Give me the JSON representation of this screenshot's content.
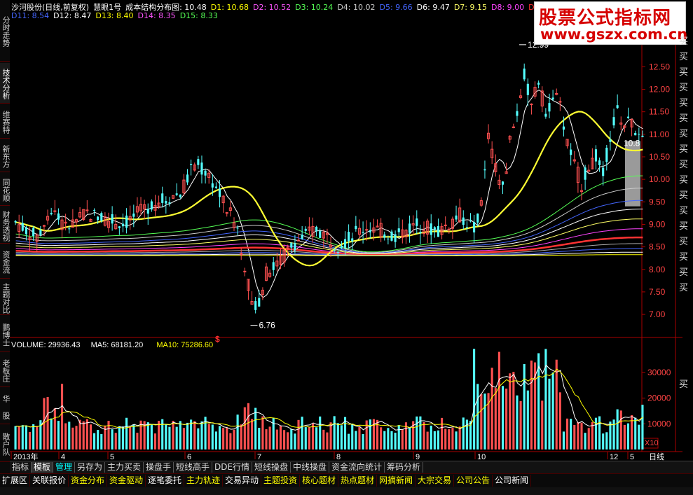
{
  "left_tabs": [
    "分时走势",
    "技术分析",
    "维赛特",
    "新东方",
    "同花顺",
    "财务透视",
    "资金流",
    "主题对比",
    "鹏博士",
    "老板庄",
    "华 股",
    "散户队"
  ],
  "header": {
    "line1": [
      {
        "text": "沙河股份(日线,前复权)",
        "color": "#ffffff"
      },
      {
        "text": "慧眼1号",
        "color": "#ffffff"
      },
      {
        "text": "成本结构分布图: 10.48",
        "color": "#ffffff"
      },
      {
        "text": "D1: 10.68",
        "color": "#ffff00"
      },
      {
        "text": "D2: 10.52",
        "color": "#ff55ff"
      },
      {
        "text": "D3: 10.24",
        "color": "#55ff55"
      },
      {
        "text": "D4: 10.02",
        "color": "#cccccc"
      },
      {
        "text": "D5: 9.66",
        "color": "#4466ff"
      },
      {
        "text": "D6: 9.47",
        "color": "#ffffff"
      },
      {
        "text": "D7: 9.15",
        "color": "#ffff66"
      },
      {
        "text": "D8: 9.00",
        "color": "#ff44ff"
      },
      {
        "text": "D9",
        "color": "#ff3333"
      }
    ],
    "line2": [
      {
        "text": "D11: 8.54",
        "color": "#4466ff"
      },
      {
        "text": "D12: 8.47",
        "color": "#ffffff"
      },
      {
        "text": "D13: 8.40",
        "color": "#ffff00"
      },
      {
        "text": "D14: 8.35",
        "color": "#ff55ff"
      },
      {
        "text": "D15: 8.33",
        "color": "#55ff55"
      }
    ]
  },
  "watermark": {
    "title": "股票公式指标网",
    "url": "www.gszx.com.cn"
  },
  "price_axis": [
    "12.50",
    "12.00",
    "11.50",
    "11.00",
    "10.50",
    "10.00",
    "9.50",
    "9.00",
    "8.50",
    "8.00",
    "7.50",
    "7.00"
  ],
  "annotations": {
    "high": "12.99",
    "low": "6.76",
    "current": "10.8",
    "marker": "$"
  },
  "volume_header": [
    {
      "text": "VOLUME: 29936.43",
      "color": "#ffffff"
    },
    {
      "text": "MA5: 68181.20",
      "color": "#ffffff"
    },
    {
      "text": "MA10: 75286.60",
      "color": "#ffff00"
    }
  ],
  "volume_axis": [
    "30000",
    "20000",
    "10000"
  ],
  "volume_unit": "X10",
  "date_axis": [
    {
      "label": "2013年",
      "color": "#ffffff"
    },
    {
      "label": "4",
      "color": "#ffffff"
    },
    {
      "label": "5",
      "color": "#ffffff"
    },
    {
      "label": "6",
      "color": "#ffffff"
    },
    {
      "label": "7",
      "color": "#ffffff"
    },
    {
      "label": "8",
      "color": "#ffffff"
    },
    {
      "label": "9",
      "color": "#ffffff"
    },
    {
      "label": "10",
      "color": "#ffffff"
    },
    {
      "label": "12",
      "color": "#ffffff"
    },
    {
      "label": "5",
      "color": "#ffffff"
    }
  ],
  "period_label": "日线",
  "right_label": "买",
  "tabs_row1": [
    "指标",
    "模板",
    "管理",
    "另存为",
    "主力买卖",
    "操盘手",
    "短线高手",
    "DDE行情",
    "短线操盘",
    "中线操盘",
    "资金流向统计",
    "筹码分析"
  ],
  "tabs_row2": [
    {
      "text": "扩展区",
      "color": "#ffffff"
    },
    {
      "text": "关联报价",
      "color": "#ffffff"
    },
    {
      "text": "资金分布",
      "color": "#ffff00"
    },
    {
      "text": "资金驱动",
      "color": "#ffff00"
    },
    {
      "text": "逐笔委托",
      "color": "#ffffff"
    },
    {
      "text": "主力轨迹",
      "color": "#ffff00"
    },
    {
      "text": "交易异动",
      "color": "#ffffff"
    },
    {
      "text": "主题投资",
      "color": "#ffff00"
    },
    {
      "text": "核心题材",
      "color": "#ffff00"
    },
    {
      "text": "热点题材",
      "color": "#ffff00"
    },
    {
      "text": "网摘新闻",
      "color": "#ffff00"
    },
    {
      "text": "大宗交易",
      "color": "#ffff00"
    },
    {
      "text": "公司公告",
      "color": "#ffff00"
    },
    {
      "text": "公司新闻",
      "color": "#ffffff"
    }
  ],
  "colors": {
    "up": "#ff5050",
    "down": "#54ffff",
    "ma_yellow": "#ffff33",
    "axis": "#aa0000"
  }
}
